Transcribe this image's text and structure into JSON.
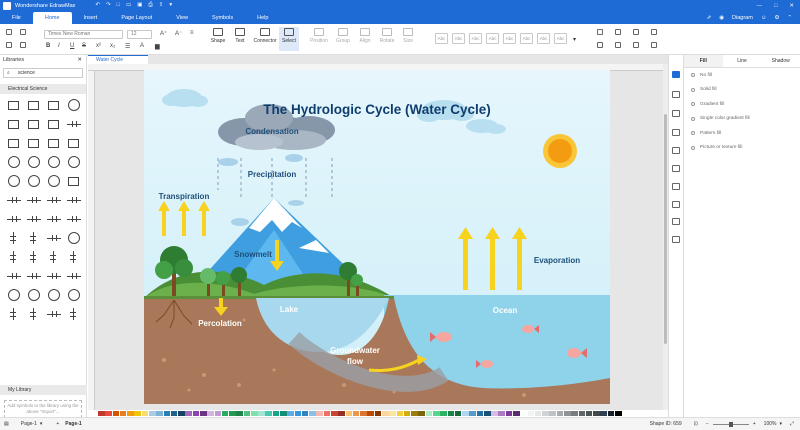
{
  "app": {
    "title": "Wondershare EdrawMax"
  },
  "menu": {
    "tabs": [
      "File",
      "Home",
      "Insert",
      "Page Layout",
      "View",
      "Symbols",
      "Help"
    ],
    "active": "Home",
    "diagram_label": "Diagram"
  },
  "ribbon": {
    "font_name": "Times New Roman",
    "font_size": "12",
    "tools": [
      "Shape",
      "Text",
      "Connector",
      "Select"
    ],
    "disabled_tools": [
      "Position",
      "Group",
      "Align",
      "Rotate",
      "Size"
    ],
    "style_swatch_label": "Abc"
  },
  "libraries": {
    "title": "Libraries",
    "search_value": "science",
    "category": "Electrical Science",
    "my_library": "My Library",
    "hint": "Add symbols to the library using the above \"Import\"..."
  },
  "document": {
    "tab": "Water Cycle"
  },
  "diagram": {
    "title": "The Hydrologic Cycle (Water Cycle)",
    "labels": {
      "condensation": "Condensation",
      "precipitation": "Precipitation",
      "transpiration": "Transpiration",
      "snowmelt": "Snowmelt",
      "evaporation": "Evaporation",
      "lake": "Lake",
      "ocean": "Ocean",
      "percolation": "Percolation",
      "groundwater": "Groundwater",
      "flow": "flow"
    }
  },
  "right_panel": {
    "tabs": [
      "Fill",
      "Line",
      "Shadow"
    ],
    "active": "Fill",
    "options": [
      "No fill",
      "Solid fill",
      "Gradient fill",
      "Single color gradient fill",
      "Pattern fill",
      "Picture or texture fill"
    ]
  },
  "status": {
    "page_select": "Page-1",
    "page_tab": "Page-1",
    "shape_id": "Shape ID: 659",
    "zoom": "100%"
  },
  "colors": {
    "brand": "#1e6bd6",
    "palette": [
      "#c0392b",
      "#e74c3c",
      "#d35400",
      "#e67e22",
      "#f39c12",
      "#f1c40f",
      "#f7dc6f",
      "#a9cce3",
      "#7fb3d5",
      "#2980b9",
      "#1f618d",
      "#154360",
      "#a569bd",
      "#8e44ad",
      "#6c3483",
      "#d2b4de",
      "#c39bd3",
      "#27ae60",
      "#229954",
      "#1e8449",
      "#52be80",
      "#82e0aa",
      "#a3e4d7",
      "#48c9b0",
      "#17a589",
      "#148f77",
      "#5dade2",
      "#3498db",
      "#2e86c1",
      "#85c1e9",
      "#f5b7b1",
      "#ec7063",
      "#cb4335",
      "#943126",
      "#f8c471",
      "#eb984e",
      "#dc7633",
      "#ba4a00",
      "#873600",
      "#fad7a0",
      "#f9e79f",
      "#f4d03f",
      "#d4ac0d",
      "#9a7d0a",
      "#7d6608",
      "#abebc6",
      "#58d68d",
      "#28b463",
      "#1d8348",
      "#186a3b",
      "#aed6f1",
      "#5499c7",
      "#2471a3",
      "#1a5276",
      "#d7bde2",
      "#af7ac5",
      "#7d3c98",
      "#5b2c6f",
      "#fdfefe",
      "#f2f3f4",
      "#e5e7e9",
      "#d0d3d4",
      "#bdc3c7",
      "#a6acaf",
      "#909497",
      "#797d7f",
      "#626567",
      "#4d5656",
      "#424949",
      "#2c3e50",
      "#17202a",
      "#000000"
    ]
  }
}
